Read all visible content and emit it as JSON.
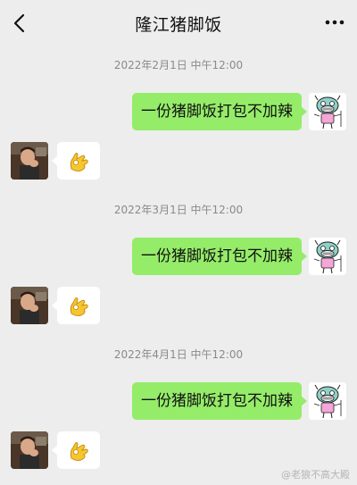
{
  "header": {
    "title": "隆江猪脚饭",
    "back_icon": "chevron-left-icon",
    "more_icon": "more-dots-icon"
  },
  "messages": [
    {
      "timestamp": "2022年2月1日 中午12:00",
      "sent_text": "一份猪脚饭打包不加辣",
      "reply_emoji": "ok-hand-emoji"
    },
    {
      "timestamp": "2022年3月1日 中午12:00",
      "sent_text": "一份猪脚饭打包不加辣",
      "reply_emoji": "ok-hand-emoji"
    },
    {
      "timestamp": "2022年4月1日 中午12:00",
      "sent_text": "一份猪脚饭打包不加辣",
      "reply_emoji": "ok-hand-emoji"
    }
  ],
  "watermark": "@老狼不高大殿",
  "colors": {
    "background": "#ededed",
    "sent_bubble": "#95ec69",
    "received_bubble": "#ffffff",
    "timestamp_text": "#8a8a8a"
  }
}
